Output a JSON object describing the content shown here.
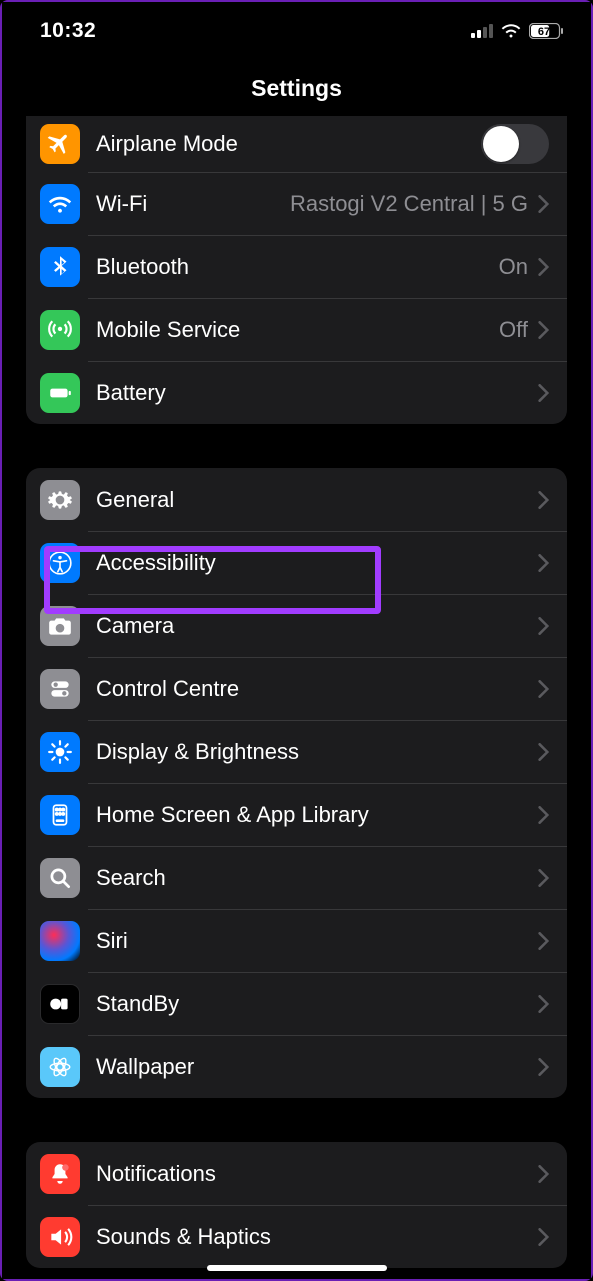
{
  "status": {
    "time": "10:32",
    "battery": "67"
  },
  "header": {
    "title": "Settings"
  },
  "group1": {
    "airplane": {
      "label": "Airplane Mode"
    },
    "wifi": {
      "label": "Wi-Fi",
      "value": "Rastogi V2 Central |  5 G"
    },
    "bluetooth": {
      "label": "Bluetooth",
      "value": "On"
    },
    "mobile": {
      "label": "Mobile Service",
      "value": "Off"
    },
    "battery": {
      "label": "Battery"
    }
  },
  "group2": {
    "general": {
      "label": "General"
    },
    "accessibility": {
      "label": "Accessibility"
    },
    "camera": {
      "label": "Camera"
    },
    "control": {
      "label": "Control Centre"
    },
    "display": {
      "label": "Display & Brightness"
    },
    "home": {
      "label": "Home Screen & App Library"
    },
    "search": {
      "label": "Search"
    },
    "siri": {
      "label": "Siri"
    },
    "standby": {
      "label": "StandBy"
    },
    "wallpaper": {
      "label": "Wallpaper"
    }
  },
  "group3": {
    "notifications": {
      "label": "Notifications"
    },
    "sounds": {
      "label": "Sounds & Haptics"
    }
  }
}
